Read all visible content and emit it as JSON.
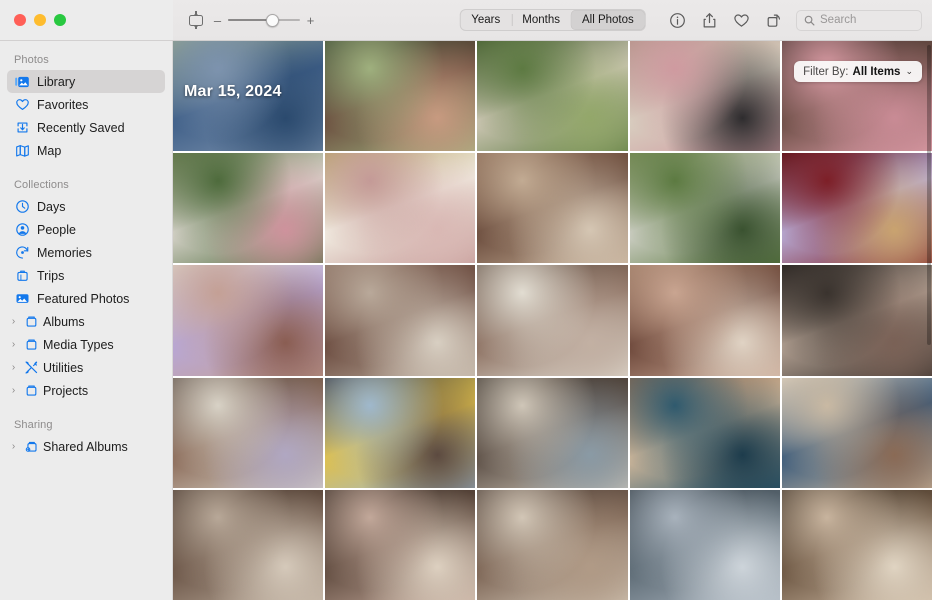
{
  "window": {
    "traffic_lights": [
      "close",
      "minimize",
      "zoom"
    ]
  },
  "toolbar": {
    "zoom_out_label": "–",
    "zoom_in_label": "+",
    "zoom_level_percent": 60,
    "segmented": [
      {
        "label": "Years",
        "active": false
      },
      {
        "label": "Months",
        "active": false
      },
      {
        "label": "All Photos",
        "active": true
      }
    ],
    "icons": [
      {
        "name": "info-icon",
        "title": "Info"
      },
      {
        "name": "share-icon",
        "title": "Share"
      },
      {
        "name": "heart-icon",
        "title": "Favorite"
      },
      {
        "name": "rotate-icon",
        "title": "Rotate"
      }
    ],
    "search": {
      "placeholder": "Search",
      "value": ""
    }
  },
  "sidebar": {
    "sections": [
      {
        "header": "Photos",
        "items": [
          {
            "label": "Library",
            "icon": "library-icon",
            "selected": true,
            "disclosure": false
          },
          {
            "label": "Favorites",
            "icon": "heart-icon",
            "selected": false,
            "disclosure": false
          },
          {
            "label": "Recently Saved",
            "icon": "recently-saved-icon",
            "selected": false,
            "disclosure": false
          },
          {
            "label": "Map",
            "icon": "map-icon",
            "selected": false,
            "disclosure": false
          }
        ]
      },
      {
        "header": "Collections",
        "items": [
          {
            "label": "Days",
            "icon": "clock-icon",
            "selected": false,
            "disclosure": false
          },
          {
            "label": "People",
            "icon": "person-icon",
            "selected": false,
            "disclosure": false
          },
          {
            "label": "Memories",
            "icon": "memories-icon",
            "selected": false,
            "disclosure": false
          },
          {
            "label": "Trips",
            "icon": "trips-icon",
            "selected": false,
            "disclosure": false
          },
          {
            "label": "Featured Photos",
            "icon": "featured-photos-icon",
            "selected": false,
            "disclosure": false
          },
          {
            "label": "Albums",
            "icon": "album-icon",
            "selected": false,
            "disclosure": true
          },
          {
            "label": "Media Types",
            "icon": "album-icon",
            "selected": false,
            "disclosure": true
          },
          {
            "label": "Utilities",
            "icon": "utilities-icon",
            "selected": false,
            "disclosure": true
          },
          {
            "label": "Projects",
            "icon": "album-icon",
            "selected": false,
            "disclosure": true
          }
        ]
      },
      {
        "header": "Sharing",
        "items": [
          {
            "label": "Shared Albums",
            "icon": "shared-album-icon",
            "selected": false,
            "disclosure": true
          }
        ]
      }
    ],
    "disclosure_glyph": "›"
  },
  "main": {
    "date_badge": "Mar 15, 2024",
    "filter": {
      "label": "Filter By:",
      "value": "All Items",
      "chevron": "⌄"
    },
    "photos": [
      {
        "alt": "person in blue knit sweater against green striped wall",
        "c1": "#7d93ae",
        "c2": "#3f5f88",
        "c3": "#2b4a6e",
        "c4": "#8fa08c"
      },
      {
        "alt": "smiling person looking through binoculars",
        "c1": "#9fb07e",
        "c2": "#6a4d3e",
        "c3": "#c79a80",
        "c4": "#3c4a33"
      },
      {
        "alt": "people standing on lawn with camera",
        "c1": "#5d7a42",
        "c2": "#cfc8b6",
        "c3": "#93a76a",
        "c4": "#4a6135"
      },
      {
        "alt": "two people embracing in pink and cream sweaters",
        "c1": "#cf9aa0",
        "c2": "#d8cfc0",
        "c3": "#2e2c2e",
        "c4": "#b2968a"
      },
      {
        "alt": "children in pink hoodies pointing",
        "c1": "#d99ba4",
        "c2": "#6b4d45",
        "c3": "#c98b95",
        "c4": "#4e3a36"
      },
      {
        "alt": "two people hugging outdoors in plaid and pink",
        "c1": "#4e6b3c",
        "c2": "#d8d4cb",
        "c3": "#ce929c",
        "c4": "#6b7d52"
      },
      {
        "alt": "close up of white dahlia flower held near face",
        "c1": "#c49a97",
        "c2": "#f2ede2",
        "c3": "#d9b8b4",
        "c4": "#b9a56d"
      },
      {
        "alt": "family cuddling together on couch",
        "c1": "#c2ab93",
        "c2": "#6a4b3c",
        "c3": "#d5c6b3",
        "c4": "#8a6a55"
      },
      {
        "alt": "child looking through binoculars in garden",
        "c1": "#5c7a41",
        "c2": "#cfd0c6",
        "c3": "#3a5230",
        "c4": "#7d8f5c"
      },
      {
        "alt": "two children on red velvet armchair",
        "c1": "#7d1f27",
        "c2": "#b9aed9",
        "c3": "#c9a36f",
        "c4": "#5c141b"
      },
      {
        "alt": "family group hug on bed in pastel clothes",
        "c1": "#c4a095",
        "c2": "#b8a7d6",
        "c3": "#8a5d52",
        "c4": "#ddd2c8"
      },
      {
        "alt": "person braiding child's hair in living room",
        "c1": "#b9a99a",
        "c2": "#6a4a3e",
        "c3": "#d8cfc2",
        "c4": "#8c7163"
      },
      {
        "alt": "adult holding child near bright window",
        "c1": "#e2ddd2",
        "c2": "#8b6f60",
        "c3": "#c2b0a3",
        "c4": "#6b5a4e"
      },
      {
        "alt": "two children leaning together on bed",
        "c1": "#c9a591",
        "c2": "#6b4639",
        "c3": "#e0d3c4",
        "c4": "#9b7a64"
      },
      {
        "alt": "person hugging child by window curtain",
        "c1": "#3a332e",
        "c2": "#b3a193",
        "c3": "#7a6156",
        "c4": "#2a2522"
      },
      {
        "alt": "two children playing by tall window",
        "c1": "#d8d2c6",
        "c2": "#8a6a58",
        "c3": "#b0a7c2",
        "c4": "#5f5148"
      },
      {
        "alt": "child and older man touching faces, yellow blanket",
        "c1": "#9fb8cc",
        "c2": "#e0c04a",
        "c3": "#5c4a40",
        "c4": "#3a3a3f"
      },
      {
        "alt": "child in striped sweater in bedroom",
        "c1": "#cfc6b8",
        "c2": "#5a4d44",
        "c3": "#8a9aa5",
        "c4": "#3e362f"
      },
      {
        "alt": "child playing on patterned rug",
        "c1": "#2f5a6e",
        "c2": "#cfb79a",
        "c3": "#1d3c4c",
        "c4": "#8a6a52"
      },
      {
        "alt": "family playing with blocks on floor",
        "c1": "#c9b9a3",
        "c2": "#3a5a7a",
        "c3": "#8a6a55",
        "c4": "#d8cdbd"
      },
      {
        "alt": "partial photo row bottom left",
        "c1": "#b8a898",
        "c2": "#6a5446",
        "c3": "#d5c9ba",
        "c4": "#4a3a30"
      },
      {
        "alt": "partial photo row bottom",
        "c1": "#c2a89a",
        "c2": "#5f4a3e",
        "c3": "#ddd0c0",
        "c4": "#3e322a"
      },
      {
        "alt": "partial photo row bottom",
        "c1": "#d2c6b6",
        "c2": "#7a6252",
        "c3": "#b09a86",
        "c4": "#4e4038"
      },
      {
        "alt": "partial photo row bottom",
        "c1": "#a8b2bc",
        "c2": "#5c6a74",
        "c3": "#cdd4da",
        "c4": "#3a444c"
      },
      {
        "alt": "partial photo row bottom",
        "c1": "#c8b49e",
        "c2": "#6a5440",
        "c3": "#e0d4c2",
        "c4": "#463a2e"
      }
    ]
  }
}
